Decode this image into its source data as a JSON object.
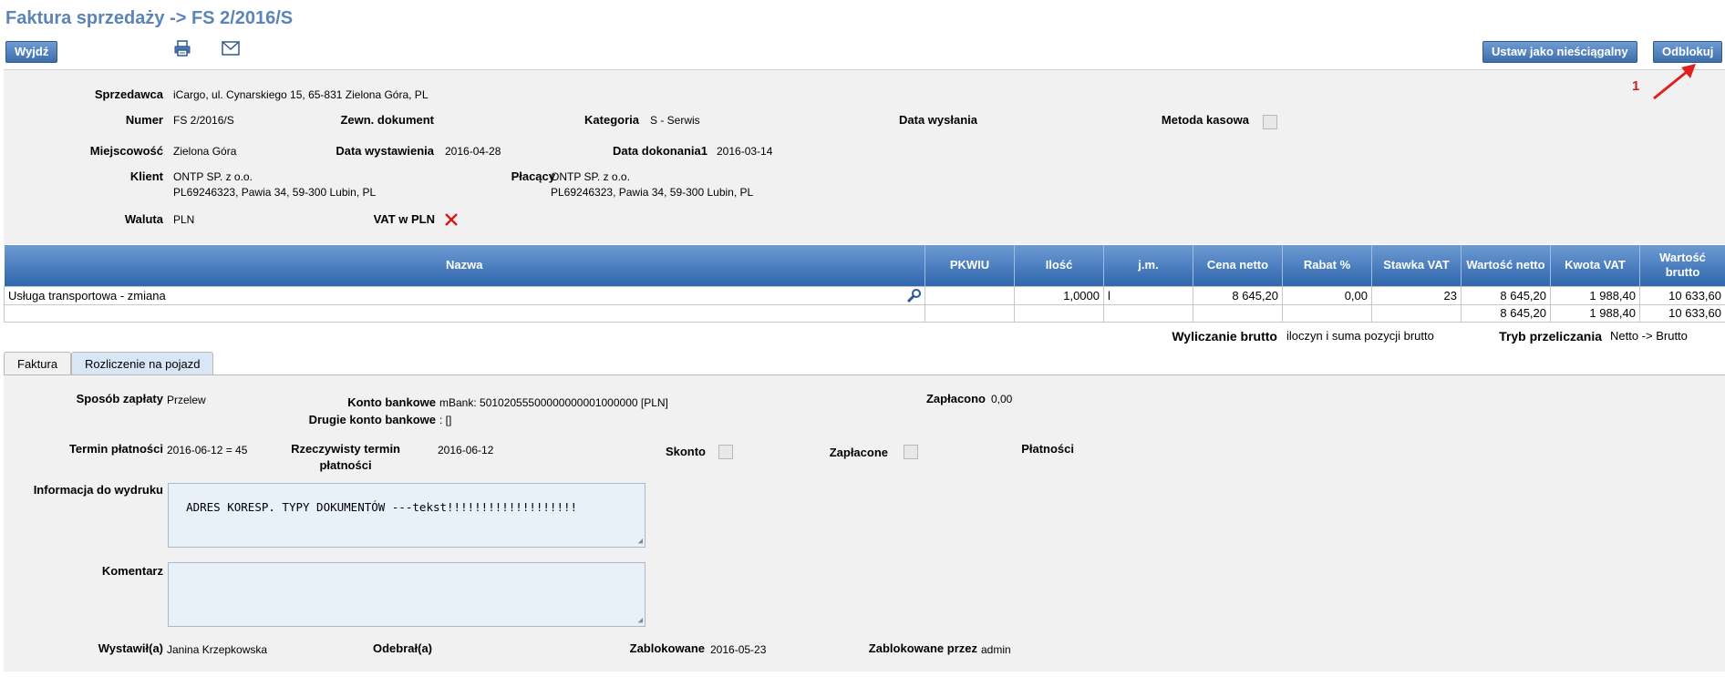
{
  "header": {
    "title": "Faktura sprzedaży -> FS 2/2016/S",
    "exit_label": "Wyjdź",
    "set_uncollectible_label": "Ustaw jako nieściągalny",
    "unlock_label": "Odblokuj",
    "print_icon": "printer-icon",
    "email_icon": "envelope-icon"
  },
  "annotation": {
    "number": "1",
    "color": "#e02020"
  },
  "invoice": {
    "seller_label": "Sprzedawca",
    "seller_value": "iCargo, ul. Cynarskiego 15, 65-831 Zielona Góra, PL",
    "number_label": "Numer",
    "number_value": "FS 2/2016/S",
    "external_doc_label": "Zewn. dokument",
    "category_label": "Kategoria",
    "category_value": "S - Serwis",
    "send_date_label": "Data wysłania",
    "cash_method_label": "Metoda kasowa",
    "city_label": "Miejscowość",
    "city_value": "Zielona Góra",
    "issue_date_label": "Data wystawienia",
    "issue_date_value": "2016-04-28",
    "completion_date_label": "Data dokonania1",
    "completion_date_value": "2016-03-14",
    "client_label": "Klient",
    "client_line1": "ONTP SP. z o.o.",
    "client_line2": "PL69246323, Pawia 34, 59-300 Lubin, PL",
    "payer_label": "Płacący",
    "payer_line1": "ONTP SP. z o.o.",
    "payer_line2": "PL69246323, Pawia 34, 59-300 Lubin, PL",
    "currency_label": "Waluta",
    "currency_value": "PLN",
    "vat_pln_label": "VAT w PLN",
    "vat_pln_icon": "red-x-icon"
  },
  "items_table": {
    "columns": [
      "Nazwa",
      "PKWIU",
      "Ilość",
      "j.m.",
      "Cena netto",
      "Rabat %",
      "Stawka VAT",
      "Wartość netto",
      "Kwota VAT",
      "Wartość brutto"
    ],
    "rows": [
      {
        "name": "Usługa transportowa - zmiana",
        "pkwiu": "",
        "qty": "1,0000",
        "unit": "l",
        "net_price": "8 645,20",
        "discount": "0,00",
        "vat_rate": "23",
        "net_value": "8 645,20",
        "vat_amount": "1 988,40",
        "gross_value": "10 633,60"
      }
    ],
    "totals": {
      "net_value": "8 645,20",
      "vat_amount": "1 988,40",
      "gross_value": "10 633,60"
    },
    "row_icon": "search-icon"
  },
  "calc": {
    "gross_calc_label": "Wyliczanie brutto",
    "gross_calc_value": "iloczyn i suma pozycji brutto",
    "mode_label": "Tryb przeliczania",
    "mode_value": "Netto -> Brutto"
  },
  "tabs": [
    {
      "label": "Faktura",
      "active": true
    },
    {
      "label": "Rozliczenie na pojazd",
      "active": false
    }
  ],
  "payment": {
    "method_label": "Sposób zapłaty",
    "method_value": "Przelew",
    "bank_label": "Konto bankowe",
    "bank_value": "mBank: 50102055500000000001000000 [PLN]",
    "bank2_label": "Drugie konto bankowe",
    "bank2_value": ": []",
    "paid_amount_label": "Zapłacono",
    "paid_amount_value": "0,00",
    "term_label": "Termin płatności",
    "term_value": "2016-06-12 = 45",
    "real_term_label_1": "Rzeczywisty termin",
    "real_term_label_2": "płatności",
    "real_term_value": "2016-06-12",
    "discount_label": "Skonto",
    "paid_label": "Zapłacone",
    "payments_label": "Płatności",
    "print_info_label": "Informacja do wydruku",
    "print_info_value": "ADRES KORESP. TYPY DOKUMENTÓW ---tekst!!!!!!!!!!!!!!!!!!!",
    "comment_label": "Komentarz",
    "comment_value": "",
    "issued_by_label": "Wystawił(a)",
    "issued_by_value": "Janina Krzepkowska",
    "received_by_label": "Odebrał(a)",
    "locked_label": "Zablokowane",
    "locked_value": "2016-05-23",
    "locked_by_label": "Zablokowane przez",
    "locked_by_value": "admin"
  }
}
